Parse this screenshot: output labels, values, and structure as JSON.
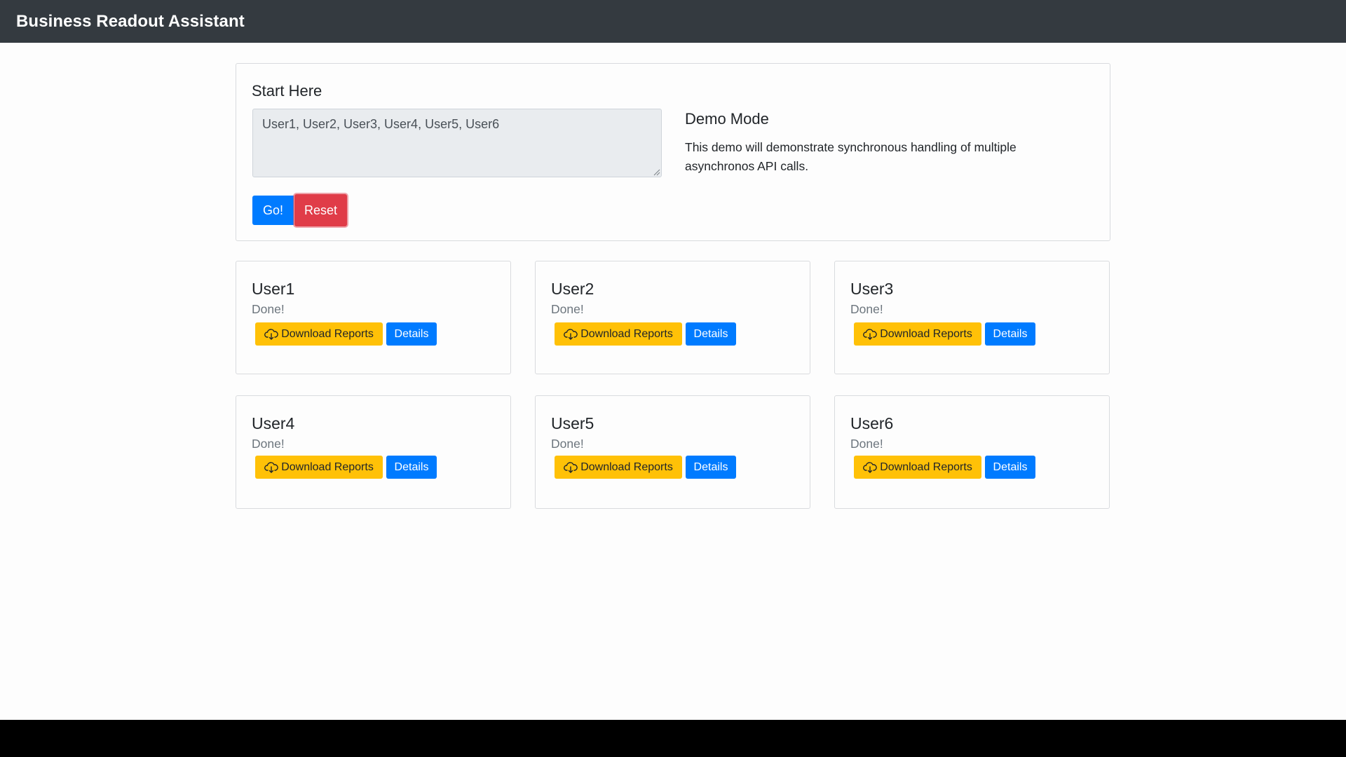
{
  "navbar": {
    "brand": "Business Readout Assistant"
  },
  "start_panel": {
    "title": "Start Here",
    "textarea_value": "User1, User2, User3, User4, User5, User6",
    "go_label": "Go!",
    "reset_label": "Reset",
    "demo_title": "Demo Mode",
    "demo_text": "This demo will demonstrate synchronous handling of multiple asynchronos API calls."
  },
  "users": [
    {
      "name": "User1",
      "status": "Done!",
      "download_label": "Download Reports",
      "details_label": "Details"
    },
    {
      "name": "User2",
      "status": "Done!",
      "download_label": "Download Reports",
      "details_label": "Details"
    },
    {
      "name": "User3",
      "status": "Done!",
      "download_label": "Download Reports",
      "details_label": "Details"
    },
    {
      "name": "User4",
      "status": "Done!",
      "download_label": "Download Reports",
      "details_label": "Details"
    },
    {
      "name": "User5",
      "status": "Done!",
      "download_label": "Download Reports",
      "details_label": "Details"
    },
    {
      "name": "User6",
      "status": "Done!",
      "download_label": "Download Reports",
      "details_label": "Details"
    }
  ],
  "icons": {
    "download": "cloud-download-icon"
  },
  "colors": {
    "navbar": "#343a40",
    "primary": "#007bff",
    "danger": "#e03c48",
    "warning": "#ffc107",
    "muted": "#6c757d"
  }
}
